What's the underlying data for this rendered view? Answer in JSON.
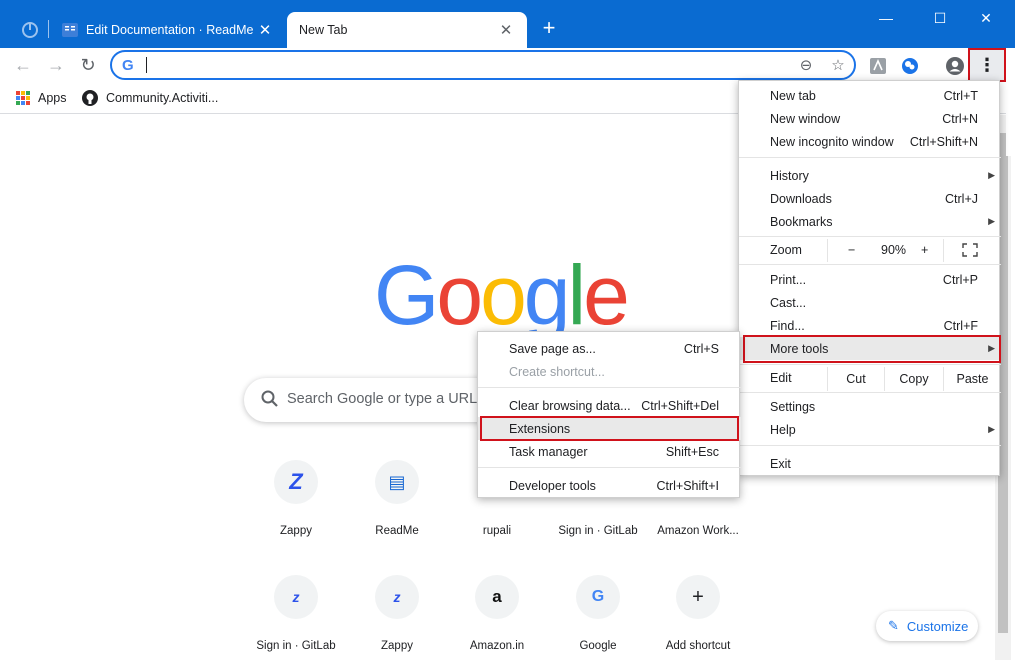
{
  "tabs": [
    {
      "title": "Edit Documentation · ReadMe",
      "active": false
    },
    {
      "title": "New Tab",
      "active": true
    }
  ],
  "window_controls": {
    "minimize": "—",
    "maximize": "☐",
    "close": "✕"
  },
  "toolbar": {
    "back_icon": "←",
    "forward_icon": "→",
    "reload_icon": "↻",
    "omnibox_value": "",
    "zoom_icon": "⊖",
    "star_icon": "☆"
  },
  "bookmarks": [
    {
      "label": "Apps",
      "icon": "apps-grid-icon"
    },
    {
      "label": "Community.Activiti...",
      "icon": "github-icon"
    }
  ],
  "page": {
    "search_placeholder": "Search Google or type a URL",
    "customize_label": "Customize",
    "shortcuts": [
      {
        "label": "Zappy",
        "glyph": "Z",
        "color": "#2c52ea"
      },
      {
        "label": "ReadMe",
        "glyph": "▤",
        "color": "#1867d2"
      },
      {
        "label": "rupali",
        "glyph": "",
        "color": "#5f6368"
      },
      {
        "label": "Sign in · GitLab",
        "glyph": "",
        "color": "#5f6368"
      },
      {
        "label": "Amazon Work...",
        "glyph": "",
        "color": "#5f6368"
      },
      {
        "label": "Sign in · GitLab",
        "glyph": "z",
        "color": "#2c52ea"
      },
      {
        "label": "Zappy",
        "glyph": "z",
        "color": "#2c52ea"
      },
      {
        "label": "Amazon.in",
        "glyph": "a",
        "color": "#111"
      },
      {
        "label": "Google",
        "glyph": "G",
        "color": "#4285f4"
      },
      {
        "label": "Add shortcut",
        "glyph": "+",
        "color": "#202124"
      }
    ]
  },
  "chrome_menu": {
    "new_tab": {
      "label": "New tab",
      "shortcut": "Ctrl+T"
    },
    "new_window": {
      "label": "New window",
      "shortcut": "Ctrl+N"
    },
    "new_incognito": {
      "label": "New incognito window",
      "shortcut": "Ctrl+Shift+N"
    },
    "history": {
      "label": "History"
    },
    "downloads": {
      "label": "Downloads",
      "shortcut": "Ctrl+J"
    },
    "bookmarks": {
      "label": "Bookmarks"
    },
    "zoom": {
      "label": "Zoom",
      "minus": "−",
      "value": "90%",
      "plus": "+"
    },
    "print": {
      "label": "Print...",
      "shortcut": "Ctrl+P"
    },
    "cast": {
      "label": "Cast..."
    },
    "find": {
      "label": "Find...",
      "shortcut": "Ctrl+F"
    },
    "more_tools": {
      "label": "More tools"
    },
    "edit": {
      "label": "Edit",
      "cut": "Cut",
      "copy": "Copy",
      "paste": "Paste"
    },
    "settings": {
      "label": "Settings"
    },
    "help": {
      "label": "Help"
    },
    "exit": {
      "label": "Exit"
    }
  },
  "more_tools_menu": {
    "save_page": {
      "label": "Save page as...",
      "shortcut": "Ctrl+S"
    },
    "create_shortcut": {
      "label": "Create shortcut..."
    },
    "clear_browsing": {
      "label": "Clear browsing data...",
      "shortcut": "Ctrl+Shift+Del"
    },
    "extensions": {
      "label": "Extensions"
    },
    "task_manager": {
      "label": "Task manager",
      "shortcut": "Shift+Esc"
    },
    "developer_tools": {
      "label": "Developer tools",
      "shortcut": "Ctrl+Shift+I"
    }
  },
  "colors": {
    "titlebar": "#0a6bd1",
    "highlight": "#d0121b",
    "accent": "#1a73e8",
    "google_blue": "#4285f4",
    "google_red": "#ea4335",
    "google_yellow": "#fbbc05",
    "google_green": "#34a853"
  }
}
